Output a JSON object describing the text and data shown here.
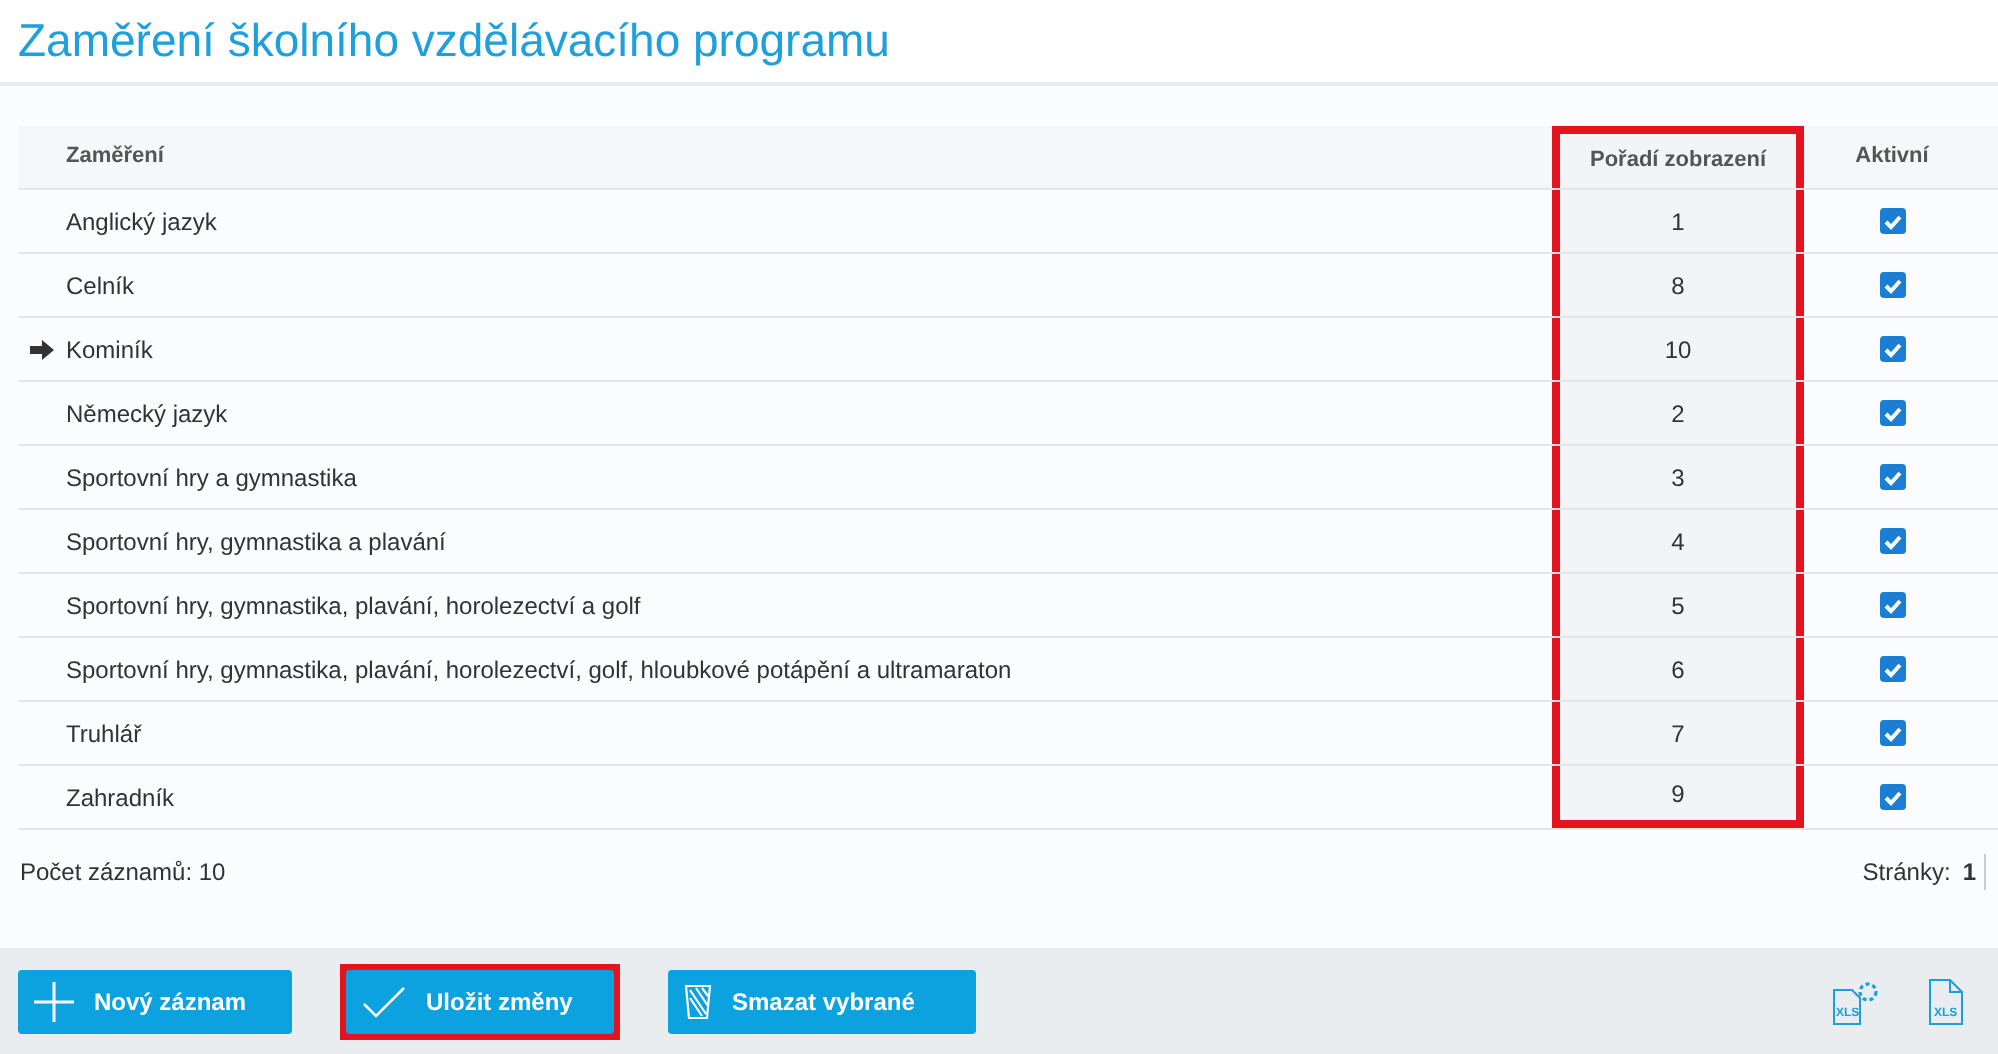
{
  "title": "Zaměření školního vzdělávacího programu",
  "table": {
    "columns": [
      {
        "label": "Zaměření",
        "highlighted": false
      },
      {
        "label": "Pořadí zobrazení",
        "highlighted": true
      },
      {
        "label": "Aktivní",
        "highlighted": false
      }
    ],
    "rows": [
      {
        "name": "Anglický jazyk",
        "order": "1",
        "active": true,
        "current": false
      },
      {
        "name": "Celník",
        "order": "8",
        "active": true,
        "current": false
      },
      {
        "name": "Kominík",
        "order": "10",
        "active": true,
        "current": true
      },
      {
        "name": "Německý jazyk",
        "order": "2",
        "active": true,
        "current": false
      },
      {
        "name": "Sportovní hry a gymnastika",
        "order": "3",
        "active": true,
        "current": false
      },
      {
        "name": "Sportovní hry, gymnastika a plavání",
        "order": "4",
        "active": true,
        "current": false
      },
      {
        "name": "Sportovní hry, gymnastika, plavání, horolezectví a golf",
        "order": "5",
        "active": true,
        "current": false
      },
      {
        "name": "Sportovní hry, gymnastika, plavání, horolezectví, golf, hloubkové potápění a ultramaraton",
        "order": "6",
        "active": true,
        "current": false
      },
      {
        "name": "Truhlář",
        "order": "7",
        "active": true,
        "current": false
      },
      {
        "name": "Zahradník",
        "order": "9",
        "active": true,
        "current": false
      }
    ]
  },
  "footer": {
    "record_count": "Počet záznamů: 10",
    "pages_label": "Stránky:",
    "page": "1"
  },
  "buttons": [
    {
      "kind": "add",
      "label": "Nový záznam",
      "highlighted": false
    },
    {
      "kind": "save",
      "label": "Uložit změny",
      "highlighted": true
    },
    {
      "kind": "delete",
      "label": "Smazat vybrané",
      "highlighted": false
    }
  ],
  "exports": [
    {
      "kind": "settings",
      "label": "XLS"
    },
    {
      "kind": "plain",
      "label": "XLS"
    }
  ]
}
